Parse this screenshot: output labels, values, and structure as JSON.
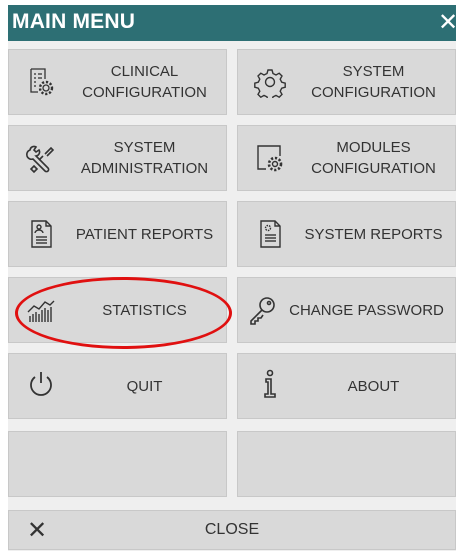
{
  "header": {
    "title": "MAIN MENU",
    "close_glyph": "✕"
  },
  "tiles": [
    {
      "label": "CLINICAL CONFIGURATION",
      "icon": "clinical-configuration-icon"
    },
    {
      "label": "SYSTEM CONFIGURATION",
      "icon": "system-configuration-icon"
    },
    {
      "label": "SYSTEM ADMINISTRATION",
      "icon": "system-administration-icon"
    },
    {
      "label": "MODULES CONFIGURATION",
      "icon": "modules-configuration-icon"
    },
    {
      "label": "PATIENT REPORTS",
      "icon": "patient-reports-icon"
    },
    {
      "label": "SYSTEM REPORTS",
      "icon": "system-reports-icon"
    },
    {
      "label": "STATISTICS",
      "icon": "statistics-icon"
    },
    {
      "label": "CHANGE PASSWORD",
      "icon": "key-icon"
    },
    {
      "label": "QUIT",
      "icon": "power-icon"
    },
    {
      "label": "ABOUT",
      "icon": "info-icon"
    }
  ],
  "close": {
    "label": "CLOSE",
    "glyph": "✕"
  },
  "colors": {
    "header_bg": "#2d6f74",
    "tile_bg": "#d9d9d9",
    "panel_bg": "#efefef",
    "highlight": "#e01010"
  }
}
